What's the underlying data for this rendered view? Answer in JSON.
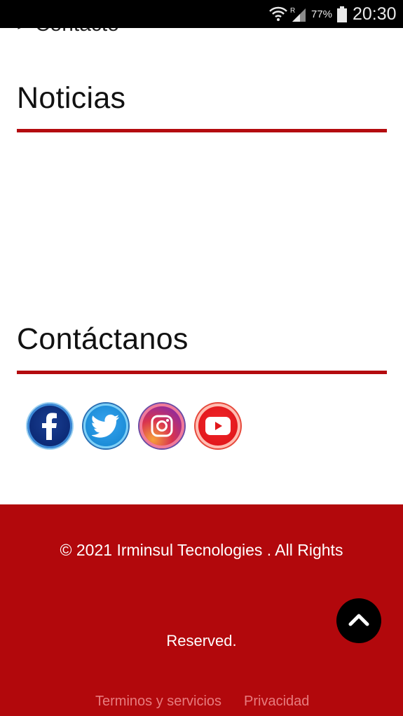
{
  "status_bar": {
    "battery_percent": "77%",
    "time": "20:30",
    "icons": [
      "wifi-icon",
      "signal-icon",
      "battery-icon"
    ]
  },
  "nav": {
    "partial_link": "> Contacto"
  },
  "sections": {
    "news_title": "Noticias",
    "contact_title": "Contáctanos"
  },
  "social": {
    "icons": [
      "facebook-icon",
      "twitter-icon",
      "instagram-icon",
      "youtube-icon"
    ]
  },
  "footer": {
    "copyright": "© 2021 Irminsul Tecnologies . All Rights",
    "reserved": "Reserved.",
    "links": [
      "Terminos y servicios",
      "Privacidad"
    ]
  },
  "colors": {
    "accent": "#b40b0f",
    "footer_bg": "#b2080c",
    "footer_link": "#e77c7e",
    "back_to_top": "#000000"
  }
}
